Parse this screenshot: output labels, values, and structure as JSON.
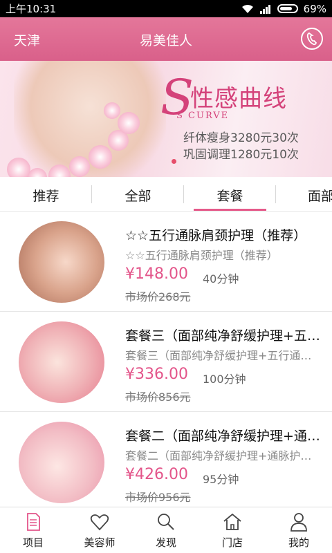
{
  "status_bar": {
    "time": "上午10:31",
    "battery": "69%"
  },
  "header": {
    "city": "天津",
    "title": "易美佳人"
  },
  "banner": {
    "big_letter": "S",
    "heading": "性感曲线",
    "sub_heading": "S CURVE",
    "line1": "纤体瘦身3280元30次",
    "line2": "巩固调理1280元10次"
  },
  "tabs": [
    {
      "label": "推荐"
    },
    {
      "label": "全部"
    },
    {
      "label": "套餐",
      "active": true
    },
    {
      "label": "面部"
    }
  ],
  "items": [
    {
      "name": "☆☆五行通脉肩颈护理（推荐）",
      "desc": "☆☆五行通脉肩颈护理（推荐）",
      "price": "¥148.00",
      "duration": "40分钟",
      "market_price": "市场价268元"
    },
    {
      "name": "套餐三（面部纯净舒缓护理+五行通脉肩颈护理）",
      "desc": "套餐三（面部纯净舒缓护理+五行通脉肩颈护理）",
      "price": "¥336.00",
      "duration": "100分钟",
      "market_price": "市场价856元"
    },
    {
      "name": "套餐二（面部纯净舒缓护理+通脉护理）",
      "desc": "套餐二（面部纯净舒缓护理+通脉护理）",
      "price": "¥426.00",
      "duration": "95分钟",
      "market_price": "市场价956元"
    }
  ],
  "bottom_nav": [
    {
      "label": "项目",
      "icon": "document-icon",
      "active": true
    },
    {
      "label": "美容师",
      "icon": "heart-icon"
    },
    {
      "label": "发现",
      "icon": "search-icon"
    },
    {
      "label": "门店",
      "icon": "home-icon"
    },
    {
      "label": "我的",
      "icon": "person-icon"
    }
  ],
  "colors": {
    "accent": "#e3558a",
    "header": "#d9608a"
  }
}
